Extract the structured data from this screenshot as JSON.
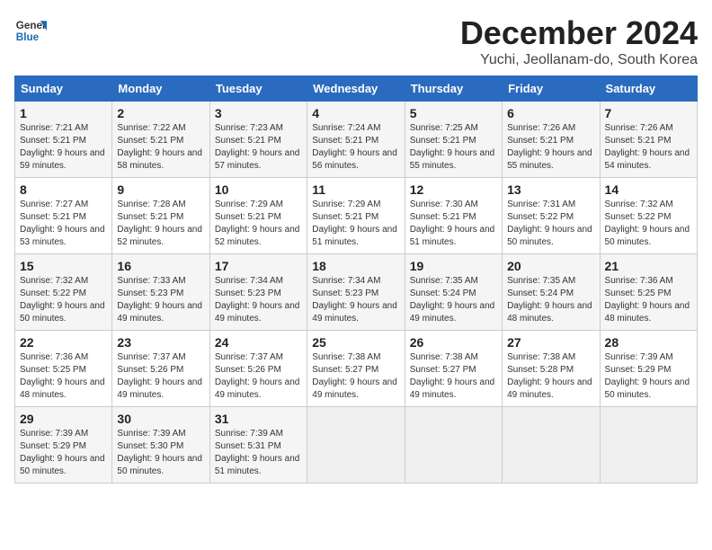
{
  "logo": {
    "line1": "General",
    "line2": "Blue"
  },
  "title": "December 2024",
  "subtitle": "Yuchi, Jeollanam-do, South Korea",
  "columns": [
    "Sunday",
    "Monday",
    "Tuesday",
    "Wednesday",
    "Thursday",
    "Friday",
    "Saturday"
  ],
  "weeks": [
    [
      {
        "day": "1",
        "sunrise": "7:21 AM",
        "sunset": "5:21 PM",
        "daylight": "9 hours and 59 minutes."
      },
      {
        "day": "2",
        "sunrise": "7:22 AM",
        "sunset": "5:21 PM",
        "daylight": "9 hours and 58 minutes."
      },
      {
        "day": "3",
        "sunrise": "7:23 AM",
        "sunset": "5:21 PM",
        "daylight": "9 hours and 57 minutes."
      },
      {
        "day": "4",
        "sunrise": "7:24 AM",
        "sunset": "5:21 PM",
        "daylight": "9 hours and 56 minutes."
      },
      {
        "day": "5",
        "sunrise": "7:25 AM",
        "sunset": "5:21 PM",
        "daylight": "9 hours and 55 minutes."
      },
      {
        "day": "6",
        "sunrise": "7:26 AM",
        "sunset": "5:21 PM",
        "daylight": "9 hours and 55 minutes."
      },
      {
        "day": "7",
        "sunrise": "7:26 AM",
        "sunset": "5:21 PM",
        "daylight": "9 hours and 54 minutes."
      }
    ],
    [
      {
        "day": "8",
        "sunrise": "7:27 AM",
        "sunset": "5:21 PM",
        "daylight": "9 hours and 53 minutes."
      },
      {
        "day": "9",
        "sunrise": "7:28 AM",
        "sunset": "5:21 PM",
        "daylight": "9 hours and 52 minutes."
      },
      {
        "day": "10",
        "sunrise": "7:29 AM",
        "sunset": "5:21 PM",
        "daylight": "9 hours and 52 minutes."
      },
      {
        "day": "11",
        "sunrise": "7:29 AM",
        "sunset": "5:21 PM",
        "daylight": "9 hours and 51 minutes."
      },
      {
        "day": "12",
        "sunrise": "7:30 AM",
        "sunset": "5:21 PM",
        "daylight": "9 hours and 51 minutes."
      },
      {
        "day": "13",
        "sunrise": "7:31 AM",
        "sunset": "5:22 PM",
        "daylight": "9 hours and 50 minutes."
      },
      {
        "day": "14",
        "sunrise": "7:32 AM",
        "sunset": "5:22 PM",
        "daylight": "9 hours and 50 minutes."
      }
    ],
    [
      {
        "day": "15",
        "sunrise": "7:32 AM",
        "sunset": "5:22 PM",
        "daylight": "9 hours and 50 minutes."
      },
      {
        "day": "16",
        "sunrise": "7:33 AM",
        "sunset": "5:23 PM",
        "daylight": "9 hours and 49 minutes."
      },
      {
        "day": "17",
        "sunrise": "7:34 AM",
        "sunset": "5:23 PM",
        "daylight": "9 hours and 49 minutes."
      },
      {
        "day": "18",
        "sunrise": "7:34 AM",
        "sunset": "5:23 PM",
        "daylight": "9 hours and 49 minutes."
      },
      {
        "day": "19",
        "sunrise": "7:35 AM",
        "sunset": "5:24 PM",
        "daylight": "9 hours and 49 minutes."
      },
      {
        "day": "20",
        "sunrise": "7:35 AM",
        "sunset": "5:24 PM",
        "daylight": "9 hours and 48 minutes."
      },
      {
        "day": "21",
        "sunrise": "7:36 AM",
        "sunset": "5:25 PM",
        "daylight": "9 hours and 48 minutes."
      }
    ],
    [
      {
        "day": "22",
        "sunrise": "7:36 AM",
        "sunset": "5:25 PM",
        "daylight": "9 hours and 48 minutes."
      },
      {
        "day": "23",
        "sunrise": "7:37 AM",
        "sunset": "5:26 PM",
        "daylight": "9 hours and 49 minutes."
      },
      {
        "day": "24",
        "sunrise": "7:37 AM",
        "sunset": "5:26 PM",
        "daylight": "9 hours and 49 minutes."
      },
      {
        "day": "25",
        "sunrise": "7:38 AM",
        "sunset": "5:27 PM",
        "daylight": "9 hours and 49 minutes."
      },
      {
        "day": "26",
        "sunrise": "7:38 AM",
        "sunset": "5:27 PM",
        "daylight": "9 hours and 49 minutes."
      },
      {
        "day": "27",
        "sunrise": "7:38 AM",
        "sunset": "5:28 PM",
        "daylight": "9 hours and 49 minutes."
      },
      {
        "day": "28",
        "sunrise": "7:39 AM",
        "sunset": "5:29 PM",
        "daylight": "9 hours and 50 minutes."
      }
    ],
    [
      {
        "day": "29",
        "sunrise": "7:39 AM",
        "sunset": "5:29 PM",
        "daylight": "9 hours and 50 minutes."
      },
      {
        "day": "30",
        "sunrise": "7:39 AM",
        "sunset": "5:30 PM",
        "daylight": "9 hours and 50 minutes."
      },
      {
        "day": "31",
        "sunrise": "7:39 AM",
        "sunset": "5:31 PM",
        "daylight": "9 hours and 51 minutes."
      },
      null,
      null,
      null,
      null
    ]
  ]
}
